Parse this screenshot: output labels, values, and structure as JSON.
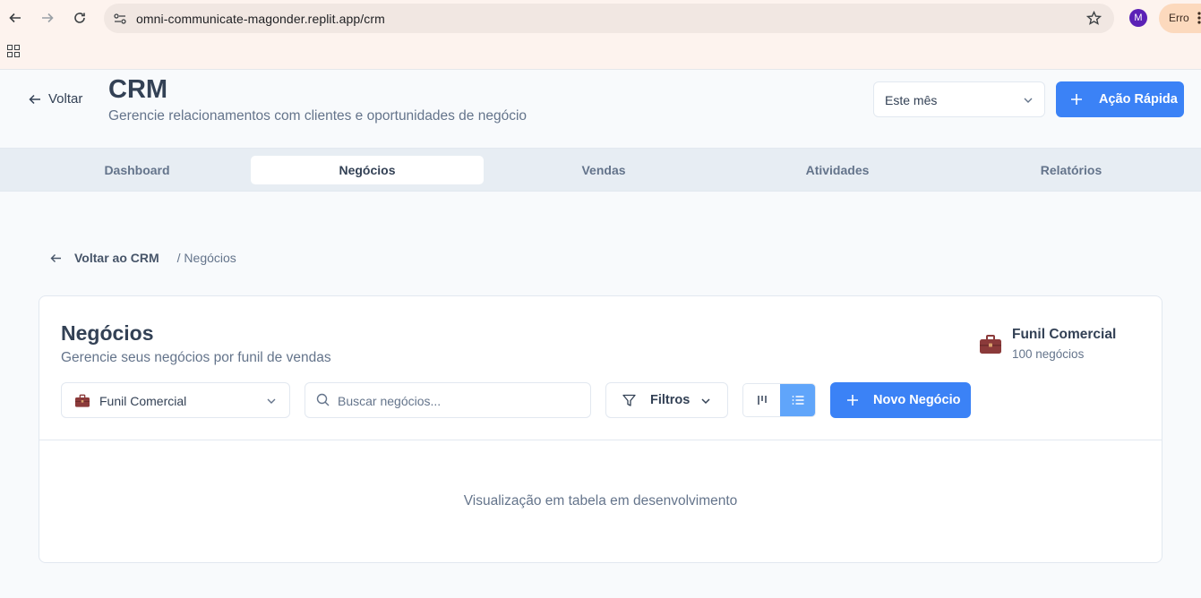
{
  "browser": {
    "url": "omni-communicate-magonder.replit.app/crm",
    "profile_initial": "M",
    "error_chip": "Erro"
  },
  "header": {
    "back_label": "Voltar",
    "title": "CRM",
    "subtitle": "Gerencie relacionamentos com clientes e oportunidades de negócio",
    "period_value": "Este mês",
    "quick_action_label": "Ação Rápida"
  },
  "tabs": [
    {
      "label": "Dashboard",
      "active": false
    },
    {
      "label": "Negócios",
      "active": true
    },
    {
      "label": "Vendas",
      "active": false
    },
    {
      "label": "Atividades",
      "active": false
    },
    {
      "label": "Relatórios",
      "active": false
    }
  ],
  "breadcrumb": {
    "back_label": "Voltar ao CRM",
    "current": "/ Negócios"
  },
  "card": {
    "title": "Negócios",
    "subtitle": "Gerencie seus negócios por funil de vendas",
    "funnel_name": "Funil Comercial",
    "funnel_count": "100 negócios",
    "funnel_select_value": "Funil Comercial",
    "search_placeholder": "Buscar negócios...",
    "filters_label": "Filtros",
    "new_deal_label": "Novo Negócio",
    "active_view": "list",
    "empty_message": "Visualização em tabela em desenvolvimento"
  },
  "colors": {
    "primary": "#3b82f6",
    "toggle_active": "#60a5fa",
    "briefcase": "#8b3a3a"
  }
}
